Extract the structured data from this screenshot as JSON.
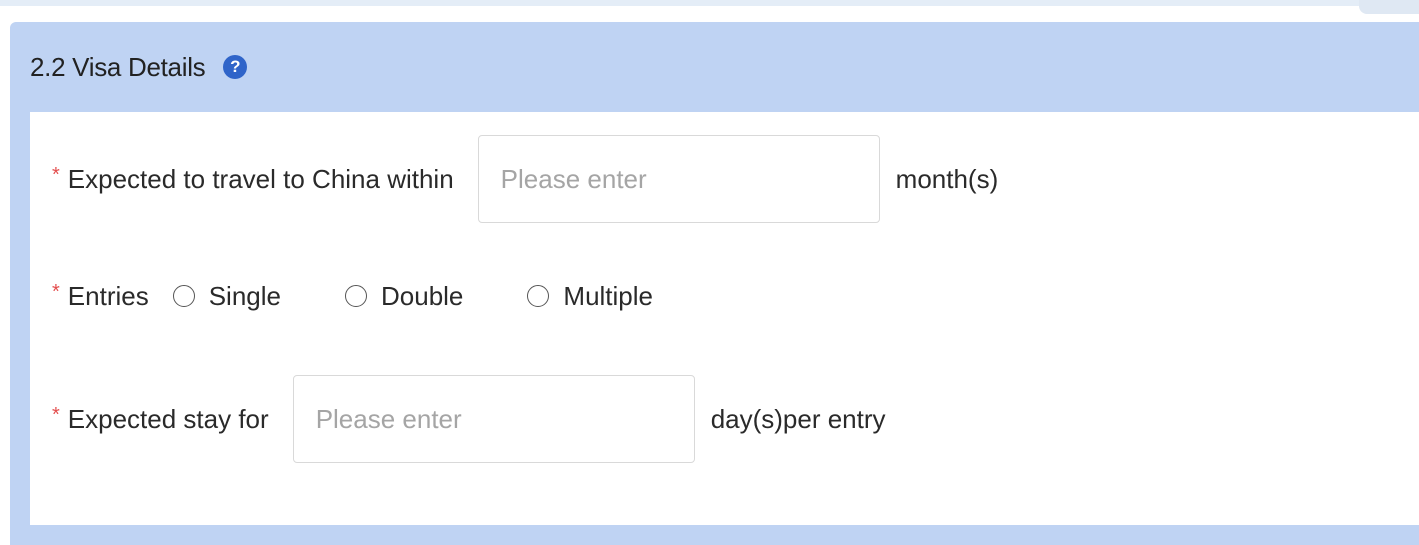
{
  "section": {
    "title": "2.2 Visa Details",
    "help_icon": "question-circle-icon",
    "accent_color": "#2f64c9",
    "header_bg": "#bfd3f3"
  },
  "fields": {
    "travel_within": {
      "required_mark": "*",
      "label": "Expected to travel to China within",
      "placeholder": "Please enter",
      "value": "",
      "unit": "month(s)"
    },
    "entries": {
      "required_mark": "*",
      "label": "Entries",
      "options": [
        "Single",
        "Double",
        "Multiple"
      ],
      "selected": null
    },
    "stay_for": {
      "required_mark": "*",
      "label": "Expected stay for",
      "placeholder": "Please enter",
      "value": "",
      "unit": "day(s)per entry"
    }
  }
}
